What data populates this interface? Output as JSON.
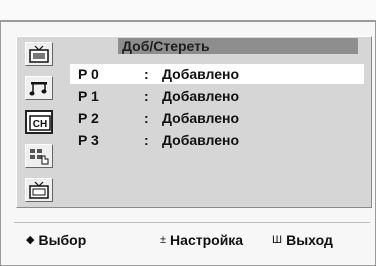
{
  "menu": {
    "title": "Доб/Стереть",
    "rows": [
      {
        "program": "P 0",
        "separator": ":",
        "status": "Добавлено"
      },
      {
        "program": "P 1",
        "separator": ":",
        "status": "Добавлено"
      },
      {
        "program": "P 2",
        "separator": ":",
        "status": "Добавлено"
      },
      {
        "program": "P 3",
        "separator": ":",
        "status": "Добавлено"
      }
    ],
    "icons": [
      "picture-icon",
      "sound-icon",
      "channel-icon",
      "function-icon",
      "setup-icon"
    ]
  },
  "help": {
    "select": {
      "glyph": "◆",
      "label": "Выбор"
    },
    "adjust": {
      "glyph": "±",
      "label": "Настройка"
    },
    "exit": {
      "glyph": "Ш",
      "label": "Выход"
    }
  },
  "colors": {
    "panel": "#d6d6d6",
    "title_bar": "#8e8e8e",
    "highlight": "#ffffff",
    "text": "#111111"
  }
}
